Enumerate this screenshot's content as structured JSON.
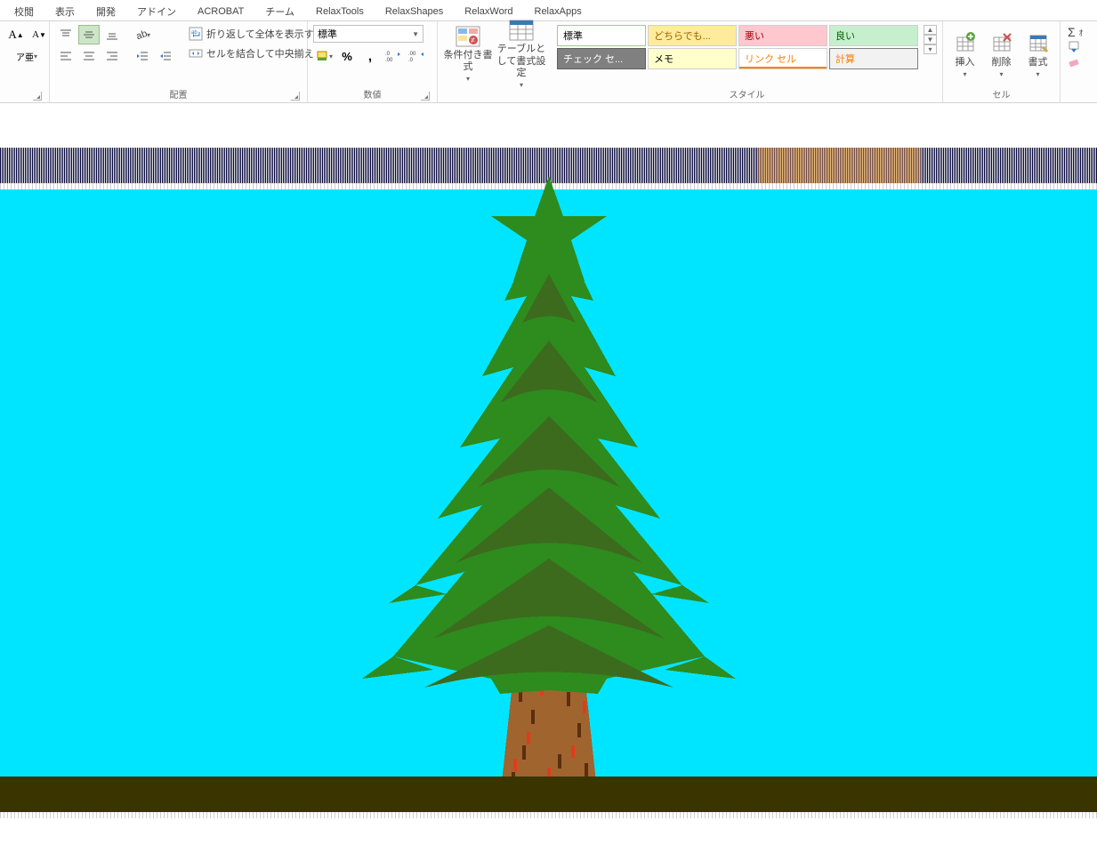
{
  "tabs": [
    "校閲",
    "表示",
    "開発",
    "アドイン",
    "ACROBAT",
    "チーム",
    "RelaxTools",
    "RelaxShapes",
    "RelaxWord",
    "RelaxApps"
  ],
  "font": {
    "increase": "A",
    "decrease": "A",
    "phonetic": "ア亜"
  },
  "alignment": {
    "group_title": "配置",
    "wrap": "折り返して全体を表示する",
    "merge": "セルを結合して中央揃え"
  },
  "number": {
    "group_title": "数値",
    "format_selected": "標準",
    "percent": "%",
    "comma": ",",
    "inc_dec": ".00",
    "dec_dec": ".00"
  },
  "cond": {
    "conditional": "条件付き書式",
    "table": "テーブルとして書式設定"
  },
  "styles": {
    "group_title": "スタイル",
    "items": [
      {
        "label": "標準",
        "bg": "#FFFFFF",
        "fg": "#000000",
        "bd": "#9CCB8E"
      },
      {
        "label": "どちらでも...",
        "bg": "#FFEB9C",
        "fg": "#9C6500",
        "bd": "#d0d0d0"
      },
      {
        "label": "悪い",
        "bg": "#FFC7CE",
        "fg": "#9C0006",
        "bd": "#d0d0d0"
      },
      {
        "label": "良い",
        "bg": "#C6EFCE",
        "fg": "#006100",
        "bd": "#d0d0d0"
      },
      {
        "label": "チェック セ...",
        "bg": "#808080",
        "fg": "#FFFFFF",
        "bd": "#606060"
      },
      {
        "label": "メモ",
        "bg": "#FFFFCC",
        "fg": "#000000",
        "bd": "#d0d0d0"
      },
      {
        "label": "リンク セル",
        "bg": "#FFFFFF",
        "fg": "#FF8001",
        "bd": "#d0d0d0",
        "ul": "#FF8001"
      },
      {
        "label": "計算",
        "bg": "#F2F2F2",
        "fg": "#FA7D00",
        "bd": "#808080"
      }
    ]
  },
  "cells": {
    "group_title": "セル",
    "insert": "挿入",
    "delete": "削除",
    "format": "書式"
  },
  "editing": {
    "sum": "Σ"
  }
}
